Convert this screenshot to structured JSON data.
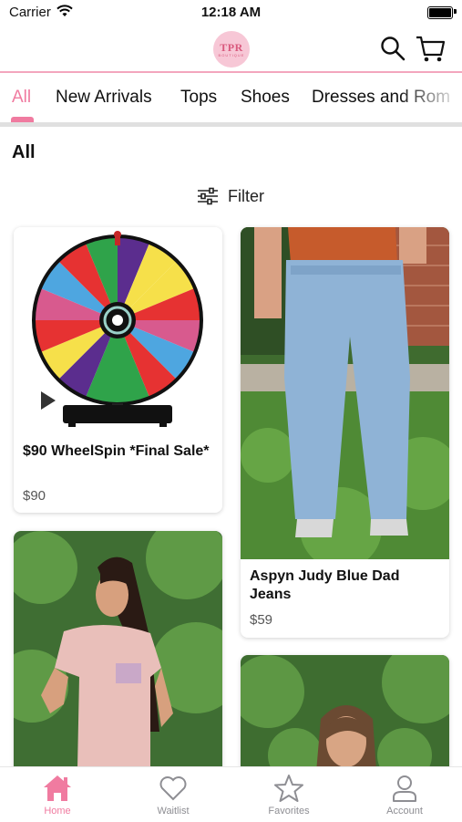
{
  "status_bar": {
    "carrier": "Carrier",
    "time": "12:18 AM"
  },
  "header": {
    "logo_text": "TPR",
    "logo_sub": "BOUTIQUE"
  },
  "category_tabs": [
    {
      "label": "All",
      "active": true
    },
    {
      "label": "New Arrivals",
      "active": false
    },
    {
      "label": "Tops",
      "active": false
    },
    {
      "label": "Shoes",
      "active": false
    },
    {
      "label": "Dresses and Rom",
      "active": false
    }
  ],
  "section_title": "All",
  "filter_label": "Filter",
  "products": [
    {
      "name": "$90 WheelSpin *Final Sale*",
      "price": "$90",
      "image": "prize-wheel"
    },
    {
      "name": "Aspyn Judy Blue Dad Jeans",
      "price": "$59",
      "image": "jeans-model"
    },
    {
      "name": "",
      "price": "",
      "image": "pink-top-model"
    },
    {
      "name": "",
      "price": "",
      "image": "model-portrait"
    }
  ],
  "tab_bar": [
    {
      "label": "Home",
      "icon": "home-icon",
      "active": true
    },
    {
      "label": "Waitlist",
      "icon": "heart-icon",
      "active": false
    },
    {
      "label": "Favorites",
      "icon": "star-icon",
      "active": false
    },
    {
      "label": "Account",
      "icon": "person-icon",
      "active": false
    }
  ],
  "colors": {
    "accent": "#f07ba0",
    "header_border": "#f3a6bd"
  }
}
